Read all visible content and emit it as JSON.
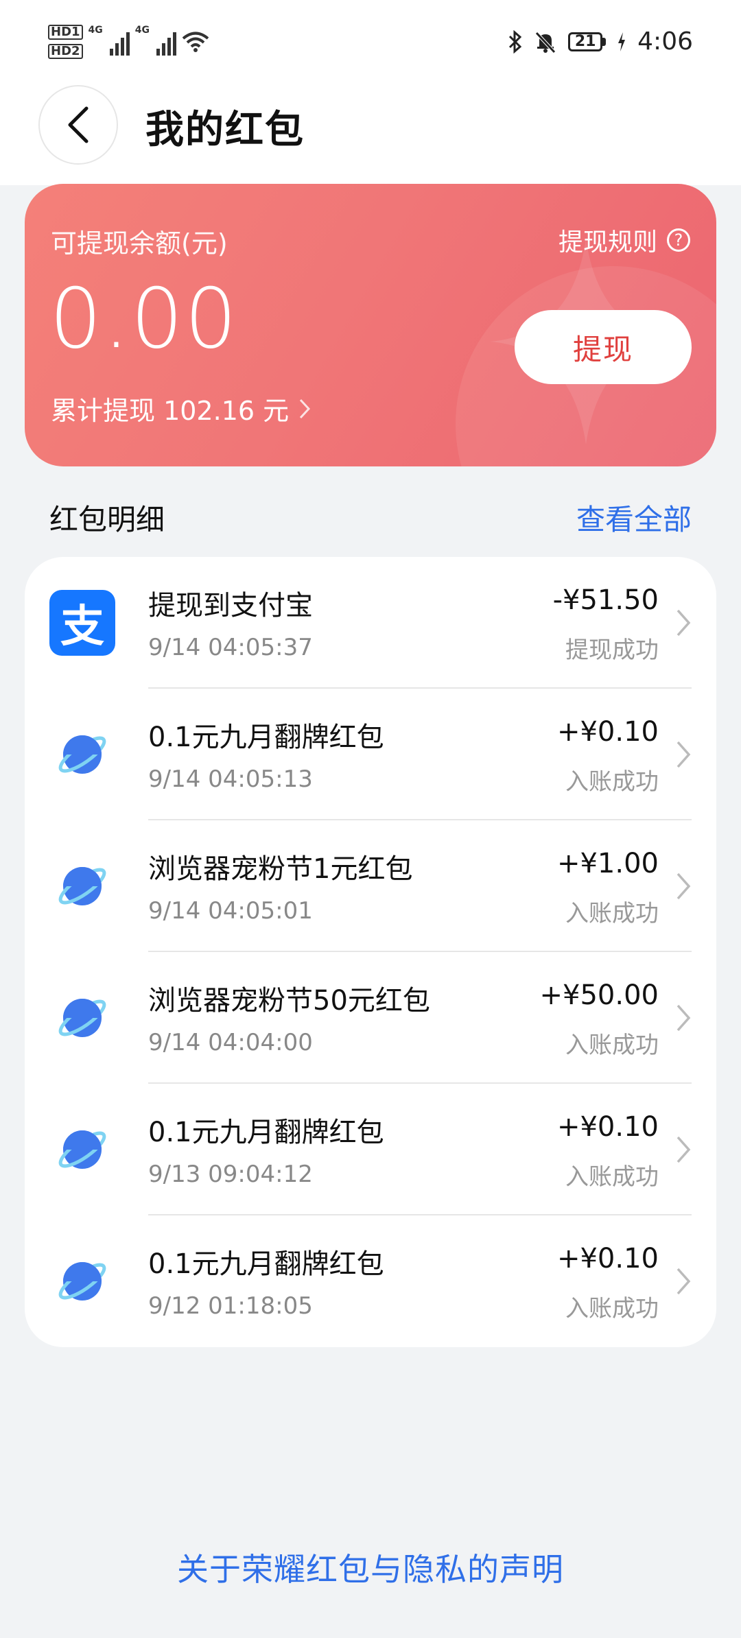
{
  "status_bar": {
    "hd1": "HD1",
    "hd2": "HD2",
    "net1": "4G",
    "net2": "4G",
    "battery": "21",
    "time": "4:06"
  },
  "header": {
    "title": "我的红包"
  },
  "balance_card": {
    "label": "可提现余额(元)",
    "amount": "0.00",
    "total_withdrawn": "累计提现 102.16 元",
    "rules_label": "提现规则",
    "withdraw_button": "提现"
  },
  "section": {
    "title": "红包明细",
    "view_all": "查看全部"
  },
  "transactions": [
    {
      "title": "提现到支付宝",
      "time": "9/14 04:05:37",
      "amount": "-¥51.50",
      "status": "提现成功",
      "icon": "alipay-icon"
    },
    {
      "title": "0.1元九月翻牌红包",
      "time": "9/14 04:05:13",
      "amount": "+¥0.10",
      "status": "入账成功",
      "icon": "browser-planet-icon"
    },
    {
      "title": "浏览器宠粉节1元红包",
      "time": "9/14 04:05:01",
      "amount": "+¥1.00",
      "status": "入账成功",
      "icon": "browser-planet-icon"
    },
    {
      "title": "浏览器宠粉节50元红包",
      "time": "9/14 04:04:00",
      "amount": "+¥50.00",
      "status": "入账成功",
      "icon": "browser-planet-icon"
    },
    {
      "title": "0.1元九月翻牌红包",
      "time": "9/13 09:04:12",
      "amount": "+¥0.10",
      "status": "入账成功",
      "icon": "browser-planet-icon"
    },
    {
      "title": "0.1元九月翻牌红包",
      "time": "9/12 01:18:05",
      "amount": "+¥0.10",
      "status": "入账成功",
      "icon": "browser-planet-icon"
    }
  ],
  "footer": {
    "privacy_link": "关于荣耀红包与隐私的声明"
  },
  "colors": {
    "accent_red": "#e0403e",
    "link_blue": "#2f6fe8",
    "card_gradient_start": "#f48079",
    "card_gradient_end": "#ec6670"
  }
}
